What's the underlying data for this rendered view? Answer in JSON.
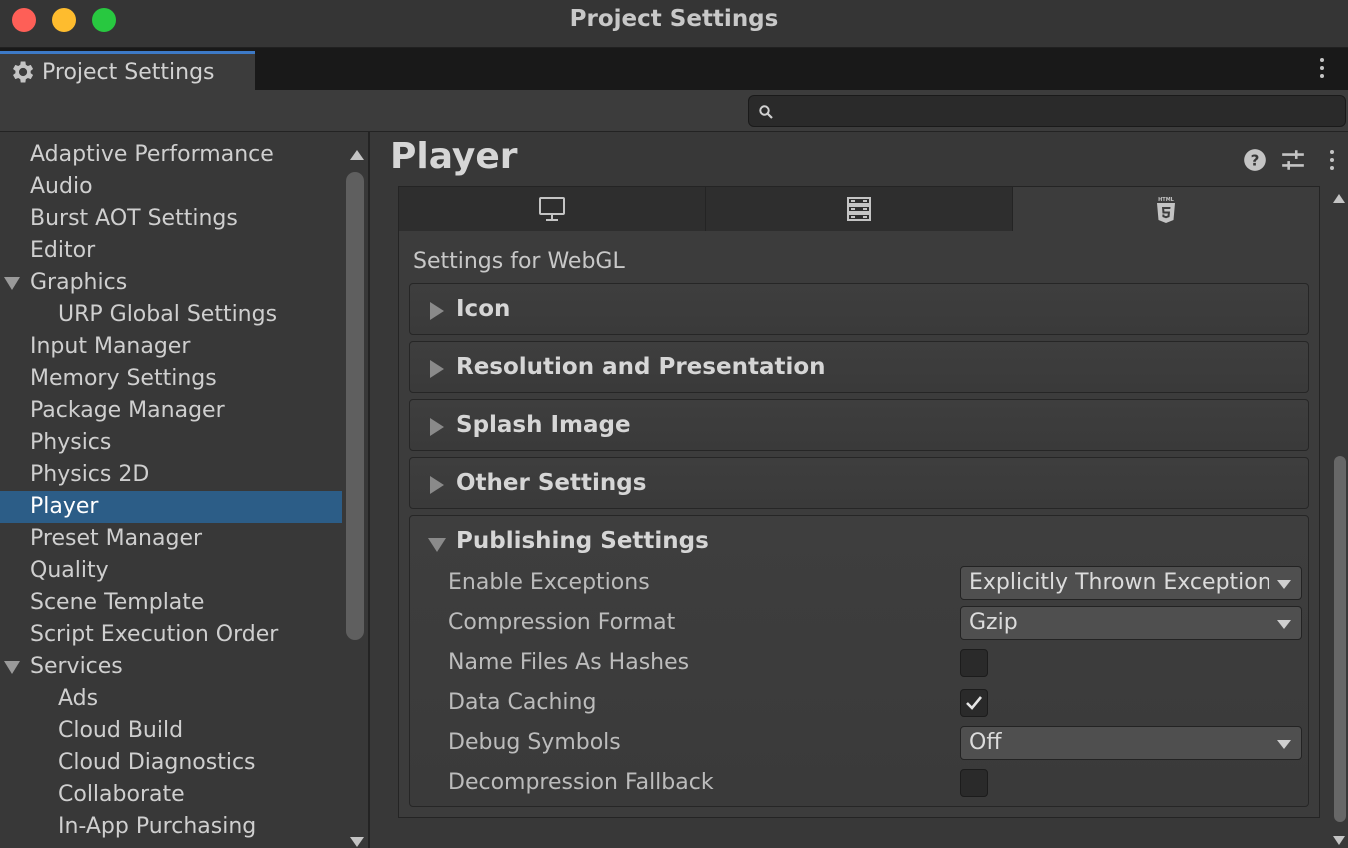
{
  "window": {
    "title": "Project Settings"
  },
  "tab": {
    "label": "Project Settings",
    "icon": "gear-icon"
  },
  "search": {
    "value": "",
    "placeholder": ""
  },
  "sidebar": {
    "selected": "Player",
    "items": [
      {
        "label": "Adaptive Performance",
        "indent": 0,
        "expandable": false
      },
      {
        "label": "Audio",
        "indent": 0,
        "expandable": false
      },
      {
        "label": "Burst AOT Settings",
        "indent": 0,
        "expandable": false
      },
      {
        "label": "Editor",
        "indent": 0,
        "expandable": false
      },
      {
        "label": "Graphics",
        "indent": 0,
        "expandable": true
      },
      {
        "label": "URP Global Settings",
        "indent": 1,
        "expandable": false
      },
      {
        "label": "Input Manager",
        "indent": 0,
        "expandable": false
      },
      {
        "label": "Memory Settings",
        "indent": 0,
        "expandable": false
      },
      {
        "label": "Package Manager",
        "indent": 0,
        "expandable": false
      },
      {
        "label": "Physics",
        "indent": 0,
        "expandable": false
      },
      {
        "label": "Physics 2D",
        "indent": 0,
        "expandable": false
      },
      {
        "label": "Player",
        "indent": 0,
        "expandable": false
      },
      {
        "label": "Preset Manager",
        "indent": 0,
        "expandable": false
      },
      {
        "label": "Quality",
        "indent": 0,
        "expandable": false
      },
      {
        "label": "Scene Template",
        "indent": 0,
        "expandable": false
      },
      {
        "label": "Script Execution Order",
        "indent": 0,
        "expandable": false
      },
      {
        "label": "Services",
        "indent": 0,
        "expandable": true
      },
      {
        "label": "Ads",
        "indent": 1,
        "expandable": false
      },
      {
        "label": "Cloud Build",
        "indent": 1,
        "expandable": false
      },
      {
        "label": "Cloud Diagnostics",
        "indent": 1,
        "expandable": false
      },
      {
        "label": "Collaborate",
        "indent": 1,
        "expandable": false
      },
      {
        "label": "In-App Purchasing",
        "indent": 1,
        "expandable": false
      }
    ]
  },
  "main": {
    "title": "Player",
    "header_icons": [
      "help-icon",
      "presets-sliders-icon",
      "more-menu-icon"
    ],
    "platform_tabs": [
      {
        "icon": "desktop-monitor-icon",
        "active": false
      },
      {
        "icon": "dedicated-server-icon",
        "active": false
      },
      {
        "icon": "html5-webgl-icon",
        "active": true
      }
    ],
    "settings_for": "Settings for WebGL",
    "sections": [
      {
        "label": "Icon",
        "expanded": false
      },
      {
        "label": "Resolution and Presentation",
        "expanded": false
      },
      {
        "label": "Splash Image",
        "expanded": false
      },
      {
        "label": "Other Settings",
        "expanded": false
      },
      {
        "label": "Publishing Settings",
        "expanded": true
      }
    ],
    "publishing": {
      "enable_exceptions": {
        "label": "Enable Exceptions",
        "value": "Explicitly Thrown Exceptions Only"
      },
      "compression_format": {
        "label": "Compression Format",
        "value": "Gzip"
      },
      "name_files_as_hashes": {
        "label": "Name Files As Hashes",
        "checked": false
      },
      "data_caching": {
        "label": "Data Caching",
        "checked": true
      },
      "debug_symbols": {
        "label": "Debug Symbols",
        "value": "Off"
      },
      "decompression_fallback": {
        "label": "Decompression Fallback",
        "checked": false
      }
    }
  },
  "colors": {
    "selection": "#2c5d87",
    "tab_accent": "#3d7ac7",
    "close": "#fe5f57",
    "minimize": "#febc2e",
    "zoom": "#28c840"
  }
}
